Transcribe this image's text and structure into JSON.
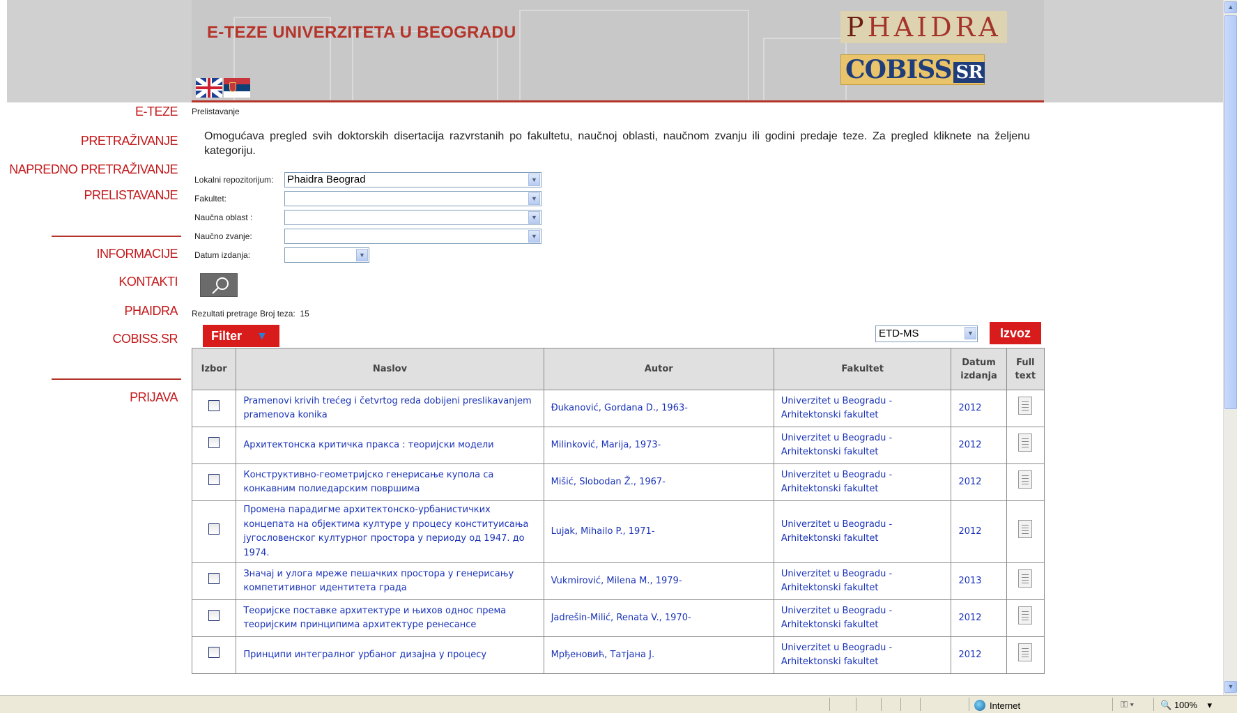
{
  "header": {
    "title": "E-TEZE UNIVERZITETA U BEOGRADU",
    "logo_phaidra": "PHAIDRA",
    "logo_cobiss": "COBISS.SR"
  },
  "nav": {
    "items": [
      "E-TEZE",
      "PRETRAŽIVANJE",
      "NAPREDNO PRETRAŽIVANJE",
      "PRELISTAVANJE",
      "INFORMACIJE",
      "KONTAKTI",
      "PHAIDRA",
      "COBISS.SR",
      "PRIJAVA"
    ]
  },
  "page": {
    "breadcrumb": "Prelistavanje",
    "intro": "Omogućava pregled svih doktorskih disertacija razvrstanih po fakultetu, naučnoj oblasti, naučnom zvanju ili godini predaje teze. Za pregled kliknete na željenu kategoriju."
  },
  "filters": {
    "repo_label": "Lokalni repozitorijum:",
    "repo_value": "Phaidra Beograd",
    "faculty_label": "Fakultet:",
    "faculty_value": "",
    "field_label": "Naučna oblast :",
    "field_value": "",
    "title_label": "Naučno zvanje:",
    "title_value": "",
    "date_label": "Datum izdanja:",
    "date_value": ""
  },
  "results": {
    "count_label": "Rezultati pretrage Broj teza:",
    "count": "15",
    "filter_label": "Filter",
    "export_format": "ETD-MS",
    "export_label": "Izvoz",
    "columns": {
      "izbor": "Izbor",
      "naslov": "Naslov",
      "autor": "Autor",
      "fakultet": "Fakultet",
      "datum": "Datum izdanja",
      "fulltext": "Full text"
    },
    "rows": [
      {
        "naslov": "Pramenovi krivih trećeg i četvrtog reda dobijeni preslikavanjem pramenova konika",
        "autor": "Đukanović, Gordana D., 1963-",
        "fakultet": "Univerzitet u Beogradu - Arhitektonski fakultet",
        "datum": "2012"
      },
      {
        "naslov": "Архитектонска критичка пракса : теоријски модели",
        "autor": "Milinković, Marija, 1973-",
        "fakultet": "Univerzitet u Beogradu - Arhitektonski fakultet",
        "datum": "2012"
      },
      {
        "naslov": "Конструктивно-геометријско генерисање купола са конкавним полиедарским површима",
        "autor": "Mišić, Slobodan Ž., 1967-",
        "fakultet": "Univerzitet u Beogradu - Arhitektonski fakultet",
        "datum": "2012"
      },
      {
        "naslov": "Промена парадигме архитектонско-урбанистичких концепата на објектима културе у процесу конституисања југословенског културног простора у периоду од 1947. до 1974.",
        "autor": "Lujak, Mihailo P., 1971-",
        "fakultet": "Univerzitet u Beogradu - Arhitektonski fakultet",
        "datum": "2012"
      },
      {
        "naslov": "Значај и улога мреже пешачких простора у генерисању компетитивног идентитета града",
        "autor": "Vukmirović, Milena M., 1979-",
        "fakultet": "Univerzitet u Beogradu - Arhitektonski fakultet",
        "datum": "2013"
      },
      {
        "naslov": "Теоријске поставке архитектуре и њихов однос према теоријским принципима архитектуре ренесансе",
        "autor": "Jadrešin-Milić, Renata V., 1970-",
        "fakultet": "Univerzitet u Beogradu - Arhitektonski fakultet",
        "datum": "2012"
      },
      {
        "naslov": "Принципи интегралног урбаног дизајна у процесу",
        "autor": "Мрђеновић, Татјана Ј.",
        "fakultet": "Univerzitet u Beogradu - Arhitektonski fakultet",
        "datum": "2012"
      }
    ]
  },
  "statusbar": {
    "zone": "Internet",
    "zoom": "100%"
  }
}
